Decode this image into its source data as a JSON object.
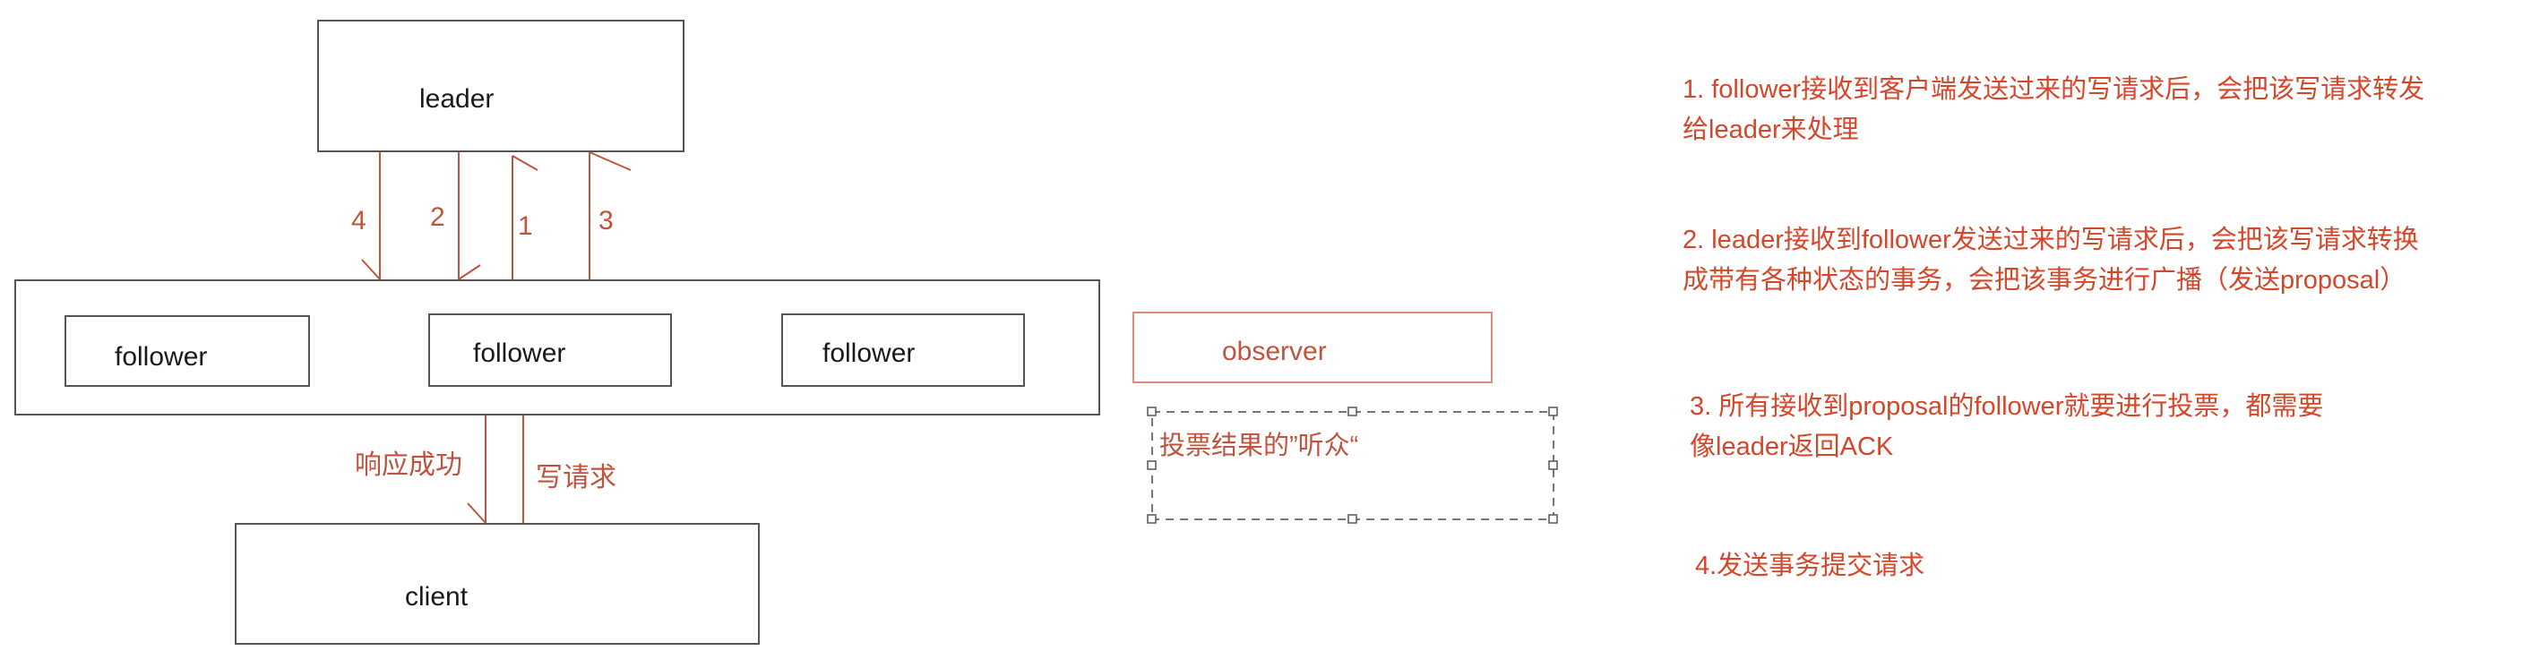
{
  "colors": {
    "line": "#555555",
    "arrow": "#c0533d",
    "note_text": "#d4472a",
    "observer_border": "#d98c7a",
    "dashed": "#777777"
  },
  "nodes": {
    "leader": "leader",
    "follower_left": "follower",
    "follower_center": "follower",
    "follower_right": "follower",
    "observer": "observer",
    "client": "client"
  },
  "arrows": {
    "a4": "4",
    "a2": "2",
    "a1": "1",
    "a3": "3",
    "response": "响应成功",
    "write_request": "写请求"
  },
  "observer_note": "投票结果的”听众“",
  "notes": {
    "n1_line1": "1. follower接收到客户端发送过来的写请求后，会把该写请求转发",
    "n1_line2": "给leader来处理",
    "n2_line1": "2. leader接收到follower发送过来的写请求后，会把该写请求转换",
    "n2_line2": "成带有各种状态的事务，会把该事务进行广播（发送proposal）",
    "n3_line1": "3. 所有接收到proposal的follower就要进行投票，都需要",
    "n3_line2": "像leader返回ACK",
    "n4_line1": "4.发送事务提交请求"
  }
}
